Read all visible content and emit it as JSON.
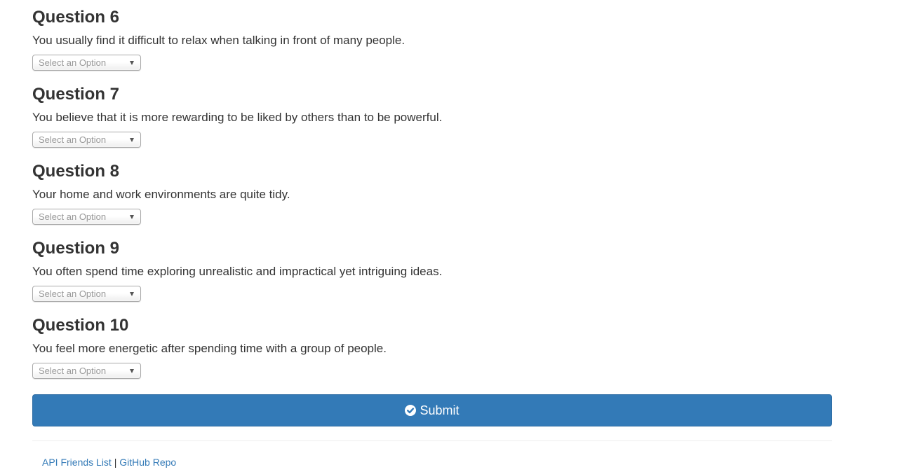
{
  "questions": [
    {
      "title": "Question 6",
      "text": "You usually find it difficult to relax when talking in front of many people.",
      "select_placeholder": "Select an Option"
    },
    {
      "title": "Question 7",
      "text": "You believe that it is more rewarding to be liked by others than to be powerful.",
      "select_placeholder": "Select an Option"
    },
    {
      "title": "Question 8",
      "text": "Your home and work environments are quite tidy.",
      "select_placeholder": "Select an Option"
    },
    {
      "title": "Question 9",
      "text": "You often spend time exploring unrealistic and impractical yet intriguing ideas.",
      "select_placeholder": "Select an Option"
    },
    {
      "title": "Question 10",
      "text": "You feel more energetic after spending time with a group of people.",
      "select_placeholder": "Select an Option"
    }
  ],
  "submit": {
    "label": "Submit",
    "icon": "check-circle-icon",
    "color": "#337ab7"
  },
  "footer": {
    "links": [
      {
        "label": "API Friends List"
      },
      {
        "label": "GitHub Repo"
      }
    ],
    "separator": "|",
    "link_color": "#337ab7"
  }
}
